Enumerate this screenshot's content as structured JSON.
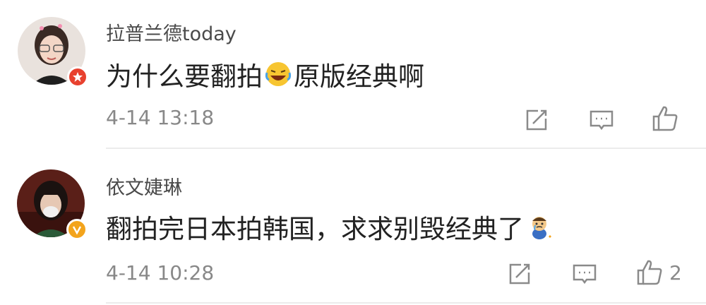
{
  "comments": [
    {
      "username": "拉普兰德today",
      "text_before": "为什么要翻拍",
      "emoji": "laugh-cry-emoji",
      "text_after": "原版经典啊",
      "timestamp": "4-14 13:18",
      "badge": "star-badge",
      "like_count": ""
    },
    {
      "username": "依文婕琳",
      "text_before": "翻拍完日本拍韩国，求求别毁经典了",
      "emoji": "crying-boy-emoji",
      "text_after": "",
      "timestamp": "4-14 10:28",
      "badge": "verified-v-badge",
      "like_count": "2"
    }
  ],
  "colors": {
    "accent_red": "#e8412f",
    "accent_orange": "#f3a41c",
    "text_gray": "#888888"
  }
}
